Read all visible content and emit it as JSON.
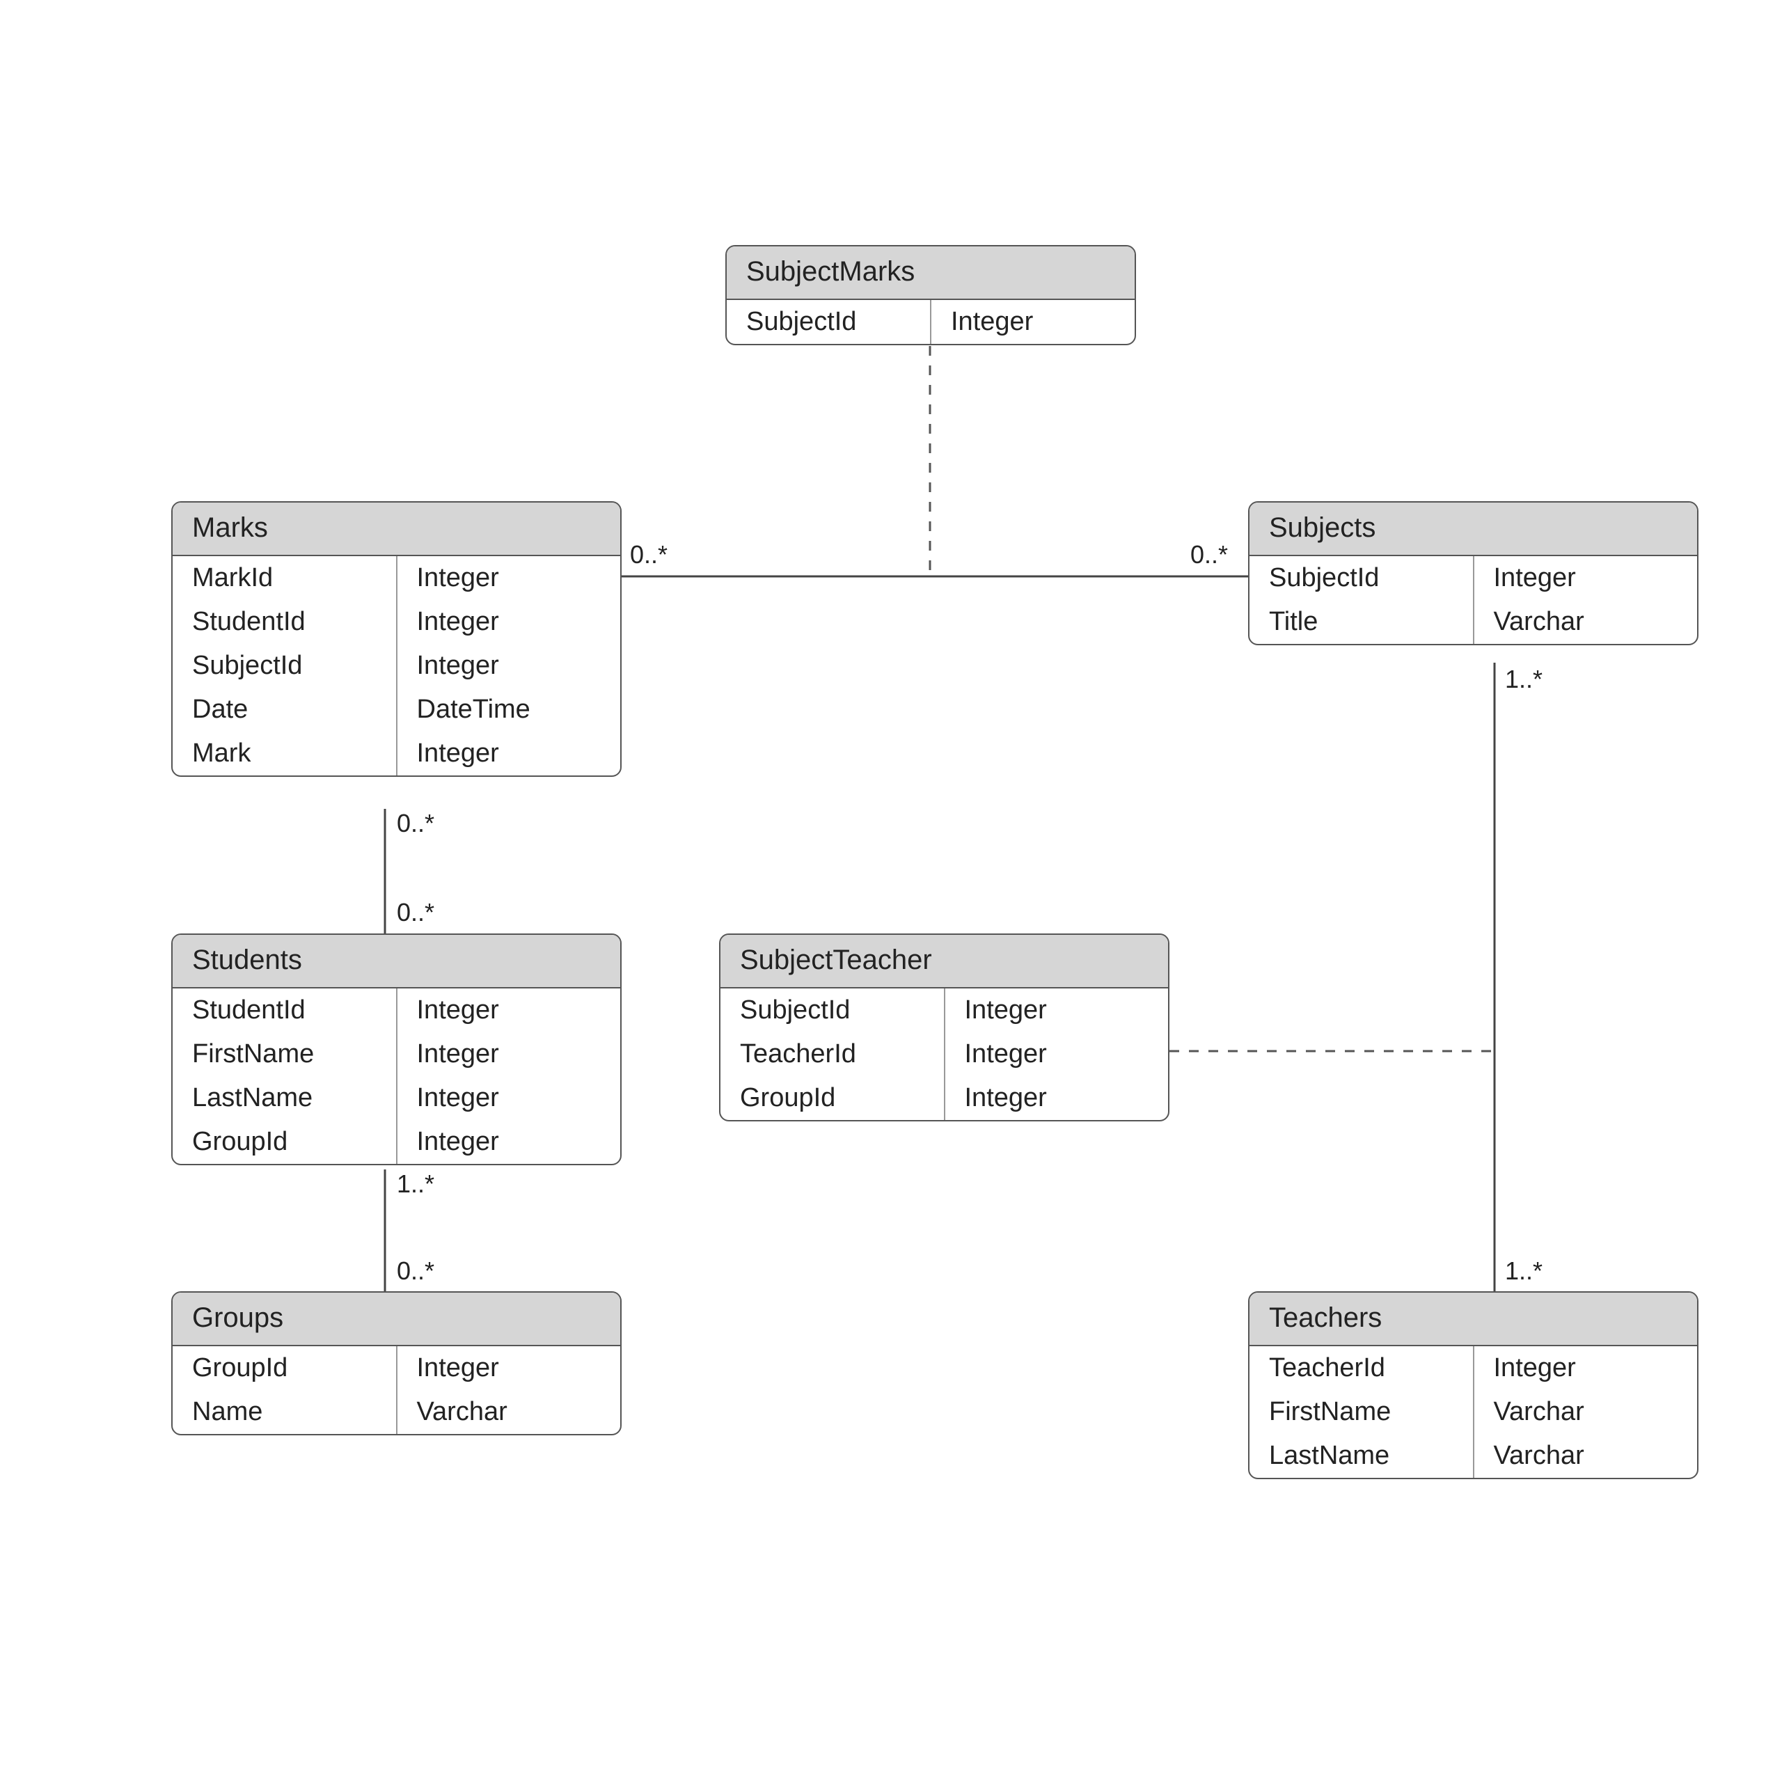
{
  "entities": {
    "subjectMarks": {
      "title": "SubjectMarks",
      "rows": [
        {
          "name": "SubjectId",
          "type": "Integer"
        }
      ]
    },
    "marks": {
      "title": "Marks",
      "rows": [
        {
          "name": "MarkId",
          "type": "Integer"
        },
        {
          "name": "StudentId",
          "type": "Integer"
        },
        {
          "name": "SubjectId",
          "type": "Integer"
        },
        {
          "name": "Date",
          "type": "DateTime"
        },
        {
          "name": "Mark",
          "type": "Integer"
        }
      ]
    },
    "subjects": {
      "title": "Subjects",
      "rows": [
        {
          "name": "SubjectId",
          "type": "Integer"
        },
        {
          "name": "Title",
          "type": "Varchar"
        }
      ]
    },
    "students": {
      "title": "Students",
      "rows": [
        {
          "name": "StudentId",
          "type": "Integer"
        },
        {
          "name": "FirstName",
          "type": "Integer"
        },
        {
          "name": "LastName",
          "type": "Integer"
        },
        {
          "name": "GroupId",
          "type": "Integer"
        }
      ]
    },
    "subjectTeacher": {
      "title": "SubjectTeacher",
      "rows": [
        {
          "name": "SubjectId",
          "type": "Integer"
        },
        {
          "name": "TeacherId",
          "type": "Integer"
        },
        {
          "name": "GroupId",
          "type": "Integer"
        }
      ]
    },
    "groups": {
      "title": "Groups",
      "rows": [
        {
          "name": "GroupId",
          "type": "Integer"
        },
        {
          "name": "Name",
          "type": "Varchar"
        }
      ]
    },
    "teachers": {
      "title": "Teachers",
      "rows": [
        {
          "name": "TeacherId",
          "type": "Integer"
        },
        {
          "name": "FirstName",
          "type": "Varchar"
        },
        {
          "name": "LastName",
          "type": "Varchar"
        }
      ]
    }
  },
  "mult": {
    "marks_subjects_left": "0..*",
    "marks_subjects_right": "0..*",
    "marks_students_top": "0..*",
    "marks_students_bot": "0..*",
    "students_groups_top": "1..*",
    "students_groups_bot": "0..*",
    "subjects_teachers_top": "1..*",
    "subjects_teachers_bot": "1..*"
  }
}
